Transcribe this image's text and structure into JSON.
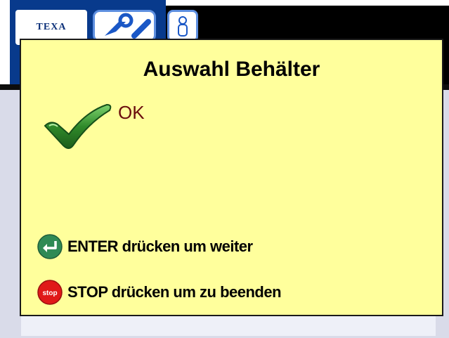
{
  "app": {
    "logo_text": "TEXA"
  },
  "dialog": {
    "title": "Auswahl Behälter",
    "status": "OK",
    "hints": {
      "enter": "ENTER drücken um weiter",
      "stop": "STOP drücken um zu beenden",
      "stop_icon_text": "stop"
    }
  },
  "icons": {
    "status": "check-icon",
    "enter": "enter-arrow-icon",
    "stop": "stop-sign-icon"
  },
  "colors": {
    "dialog_bg": "#ffff9c",
    "status_text": "#6b0d0d",
    "check_green": "#2f8a2a",
    "enter_green": "#2f8a55",
    "stop_red": "#e01919"
  }
}
